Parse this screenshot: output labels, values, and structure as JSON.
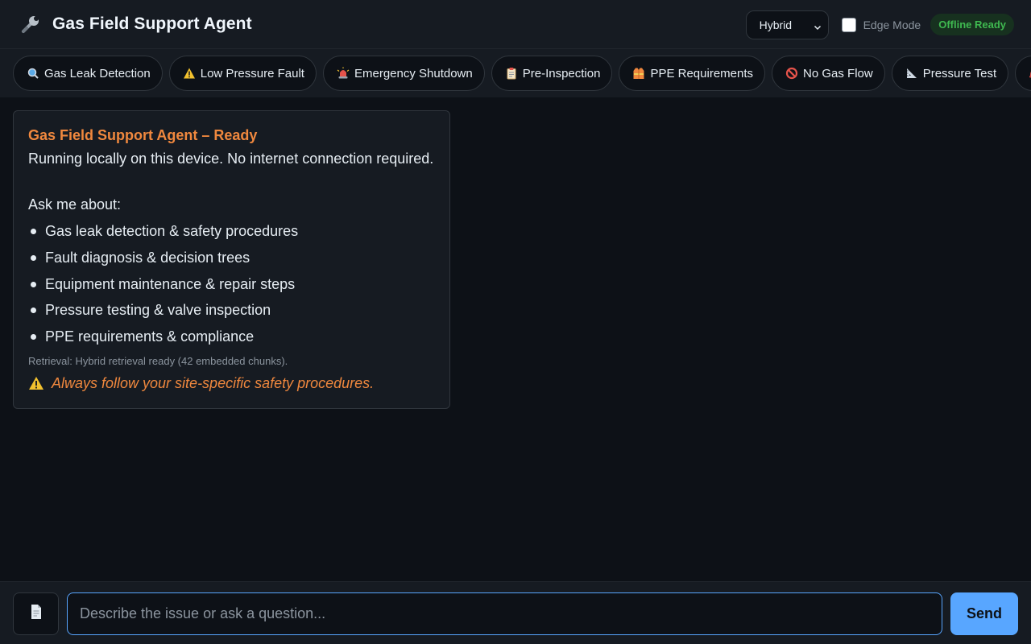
{
  "header": {
    "title": "Gas Field Support Agent",
    "icon": "wrench-icon",
    "mode_select": {
      "value": "Hybrid"
    },
    "edge_mode": {
      "label": "Edge Mode",
      "checked": false
    },
    "status_badge": "Offline Ready"
  },
  "quick_actions": [
    {
      "label": "Gas Leak Detection",
      "icon": "magnifier-icon"
    },
    {
      "label": "Low Pressure Fault",
      "icon": "warning-icon"
    },
    {
      "label": "Emergency Shutdown",
      "icon": "siren-icon"
    },
    {
      "label": "Pre-Inspection",
      "icon": "clipboard-icon"
    },
    {
      "label": "PPE Requirements",
      "icon": "safety-vest-icon"
    },
    {
      "label": "No Gas Flow",
      "icon": "prohibited-icon"
    },
    {
      "label": "Pressure Test",
      "icon": "triangular-ruler-icon"
    },
    {
      "label": "",
      "icon": "helmet-icon"
    }
  ],
  "welcome": {
    "title": "Gas Field Support Agent – Ready",
    "subtitle": "Running locally on this device. No internet connection required.",
    "ask": "Ask me about:",
    "topics": [
      "Gas leak detection & safety procedures",
      "Fault diagnosis & decision trees",
      "Equipment maintenance & repair steps",
      "Pressure testing & valve inspection",
      "PPE requirements & compliance"
    ],
    "retrieval": "Retrieval: Hybrid retrieval ready (42 embedded chunks).",
    "warning": "Always follow your site-specific safety procedures."
  },
  "composer": {
    "placeholder": "Describe the issue or ask a question...",
    "value": "",
    "send_label": "Send",
    "attach_icon": "document-icon"
  },
  "colors": {
    "background": "#0d1117",
    "panel": "#161b22",
    "accent_orange": "#f0883e",
    "accent_blue": "#58a6ff",
    "status_green": "#3fb950"
  }
}
